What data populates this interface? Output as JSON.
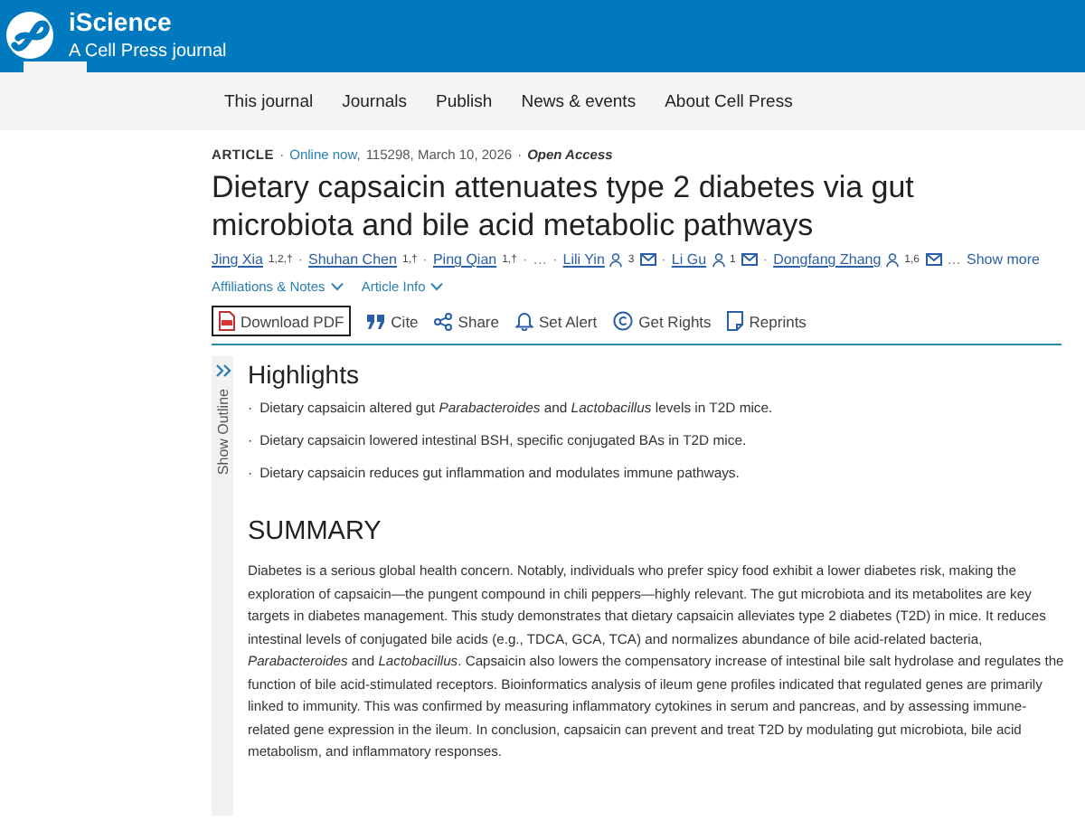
{
  "header": {
    "brand": "iScience",
    "tagline": "A Cell Press journal"
  },
  "nav": [
    "This journal",
    "Journals",
    "Publish",
    "News & events",
    "About Cell Press"
  ],
  "article": {
    "type": "ARTICLE",
    "sep1": "·",
    "online": "Online now,",
    "meta": "115298, March 10, 2026",
    "sep2": "·",
    "access": "Open Access",
    "author_separator": "·",
    "title": "Dietary capsaicin attenuates type 2 diabetes via gut microbiota and bile acid metabolic pathways",
    "authors": [
      {
        "kind": "author",
        "name": "Jing Xia",
        "sup": "1,2,†",
        "corresponding": false,
        "email": false
      },
      {
        "kind": "author",
        "name": "Shuhan Chen",
        "sup": "1,†",
        "corresponding": false,
        "email": false
      },
      {
        "kind": "author",
        "name": "Ping Qian",
        "sup": "1,†",
        "corresponding": false,
        "email": false
      },
      {
        "kind": "ellipsis",
        "text": "…"
      },
      {
        "kind": "author",
        "name": "Lili Yin",
        "sup": "3",
        "corresponding": true,
        "email": true
      },
      {
        "kind": "author",
        "name": "Li Gu",
        "sup": "1",
        "corresponding": true,
        "email": true
      },
      {
        "kind": "author",
        "name": "Dongfang Zhang",
        "sup": "1,6",
        "corresponding": true,
        "email": true
      }
    ],
    "more_ellipsis": "…",
    "show_more": "Show more",
    "toggles": [
      "Affiliations & Notes",
      "Article Info"
    ],
    "actions": [
      {
        "kind": "pdf",
        "label": "Download PDF"
      },
      {
        "kind": "cite",
        "label": "Cite"
      },
      {
        "kind": "share",
        "label": "Share"
      },
      {
        "kind": "alert",
        "label": "Set Alert"
      },
      {
        "kind": "rights",
        "label": "Get Rights"
      },
      {
        "kind": "reprints",
        "label": "Reprints"
      }
    ]
  },
  "outline": {
    "label": "Show Outline"
  },
  "highlights": {
    "heading": "Highlights",
    "items": [
      {
        "bullet": "·",
        "text": "Dietary capsaicin altered gut *Parabacteroides* and *Lactobacillus* levels in T2D mice."
      },
      {
        "bullet": "·",
        "text": "Dietary capsaicin lowered intestinal BSH, specific conjugated BAs in T2D mice."
      },
      {
        "bullet": "·",
        "text": "Dietary capsaicin reduces gut inflammation and modulates immune pathways."
      }
    ]
  },
  "summary": {
    "heading": "SUMMARY",
    "text": "Diabetes is a serious global health concern. Notably, individuals who prefer spicy food exhibit a lower diabetes risk, making the exploration of capsaicin—the pungent compound in chili peppers—highly relevant. The gut microbiota and its metabolites are key targets in diabetes management. This study demonstrates that dietary capsaicin alleviates type 2 diabetes (T2D) in mice. It reduces intestinal levels of conjugated bile acids (e.g., TDCA, GCA, TCA) and normalizes abundance of bile acid-related bacteria, *Parabacteroides* and *Lactobacillus*. Capsaicin also lowers the compensatory increase of intestinal bile salt hydrolase and regulates the function of bile acid-stimulated receptors. Bioinformatics analysis of ileum gene profiles indicated that regulated genes are primarily linked to immunity. This was confirmed by measuring inflammatory cytokines in serum and pancreas, and by assessing immune-related gene expression in the ileum. In conclusion, capsaicin can prevent and treat T2D by modulating gut microbiota, bile acid metabolism, and inflammatory responses."
  }
}
